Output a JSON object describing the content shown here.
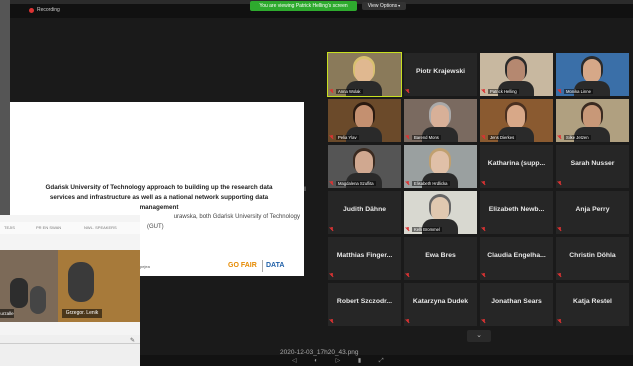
{
  "top": {
    "recording_label": "Recording",
    "viewing_banner": "You are viewing Patrick Helling's screen",
    "view_options": "View Options",
    "view_options_chevron": "▾"
  },
  "slide": {
    "title_lines": [
      "Gdańsk University of Technology approach to building up the research data",
      "services and infrastructure as well as a national network supporting data",
      "management"
    ],
    "authors_lines": [
      "urawska, both Gdańsk University of Technology",
      "(GUT)"
    ],
    "logo_gofair": "GO FAIR",
    "logo_data": "DATA",
    "left_note": "pejea"
  },
  "overlay": {
    "bar_items": [
      "TEJIS",
      "PR EN SWAN",
      "NWL. SPEAKERS"
    ],
    "name_left": "urzalle",
    "name_main": "Grzegor. Lenik",
    "edit_icon": "✎"
  },
  "participants": [
    {
      "name": "Anna Wolak",
      "video": true,
      "bg": "#8a7a5a",
      "skin": "#e0b890",
      "hair": "#d8c070",
      "active": true
    },
    {
      "name": "Piotr Krajewski",
      "video": false
    },
    {
      "name": "Patrick Helling",
      "video": true,
      "bg": "#c8b8a0",
      "skin": "#b58870",
      "hair": "#2a2a2a"
    },
    {
      "name": "Monika Linne",
      "video": true,
      "bg": "#3a6fa8",
      "skin": "#d6a888",
      "hair": "#2b2b2b"
    },
    {
      "name": "Pelia Ylav",
      "video": true,
      "bg": "#6b4a2a",
      "skin": "#c49070",
      "hair": "#2a1a10"
    },
    {
      "name": "Barend Mons",
      "video": true,
      "bg": "#7a6a60",
      "skin": "#d8b098",
      "hair": "#aaa"
    },
    {
      "name": "Jens Dierkes",
      "video": true,
      "bg": "#8a5a30",
      "skin": "#d8a888",
      "hair": "#4a3020"
    },
    {
      "name": "Silke Jetzen",
      "video": true,
      "bg": "#b0a080",
      "skin": "#c89878",
      "hair": "#3a2a20"
    },
    {
      "name": "Magdalena Szuflita",
      "video": true,
      "bg": "#555",
      "skin": "#d0a890",
      "hair": "#3a2a20"
    },
    {
      "name": "Elisabeth Hrdlicka",
      "video": true,
      "bg": "#9aa0a0",
      "skin": "#e0c0a8",
      "hair": "#c0a070"
    },
    {
      "name": "Katharina (supp...",
      "video": false
    },
    {
      "name": "Sarah Nusser",
      "video": false
    },
    {
      "name": "Judith Dähne",
      "video": false
    },
    {
      "name": "Kelli Brommel",
      "video": true,
      "bg": "#d8d8d0",
      "skin": "#e0c8b0",
      "hair": "#666"
    },
    {
      "name": "Elizabeth Newb...",
      "video": false
    },
    {
      "name": "Anja Perry",
      "video": false
    },
    {
      "name": "Matthias Finger...",
      "video": false
    },
    {
      "name": "Ewa Bres",
      "video": false
    },
    {
      "name": "Claudia Engelha...",
      "video": false
    },
    {
      "name": "Christin Döhla",
      "video": false
    },
    {
      "name": "Robert Szczodr...",
      "video": false
    },
    {
      "name": "Katarzyna Dudek",
      "video": false
    },
    {
      "name": "Jonathan Sears",
      "video": false
    },
    {
      "name": "Katja Restel",
      "video": false
    }
  ],
  "pager_icon": "⌄",
  "filename": "2020-12-03_17h20_43.png",
  "toolbar_icons": "◁ ◐ ▷ ▮ ⤢",
  "colors": {
    "accent_green": "#2eaa2e",
    "active_outline": "#c8e020",
    "muted_red": "#d33"
  }
}
